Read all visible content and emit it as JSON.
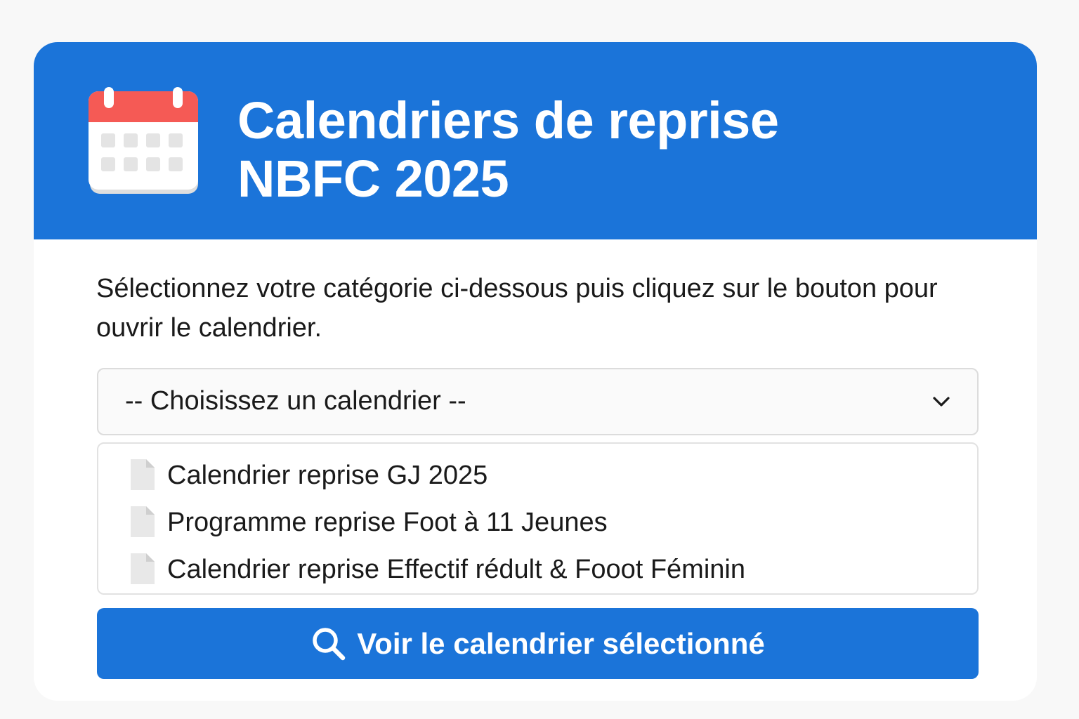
{
  "header": {
    "title_line1": "Calendriers de reprise",
    "title_line2": "NBFC 2025",
    "icon": "calendar-icon"
  },
  "intro": {
    "text": "Sélectionnez votre catégorie ci-dessous puis cliquez sur le bouton pour ouvrir le calendrier."
  },
  "select": {
    "selected_label": "-- Choisissez un calendrier --",
    "icon": "chevron-down-icon"
  },
  "options": [
    {
      "label": "Calendrier reprise GJ 2025",
      "icon": "document-icon"
    },
    {
      "label": "Programme reprise Foot à 11 Jeunes",
      "icon": "document-icon"
    },
    {
      "label": "Calendrier reprise Effectif rédult & Fooot Féminin",
      "icon": "document-icon"
    }
  ],
  "button": {
    "label": "Voir le calendrier sélectionné",
    "icon": "search-icon"
  },
  "colors": {
    "primary": "#1b74d9",
    "calendar_top": "#f55a55",
    "background": "#f8f8f8"
  }
}
